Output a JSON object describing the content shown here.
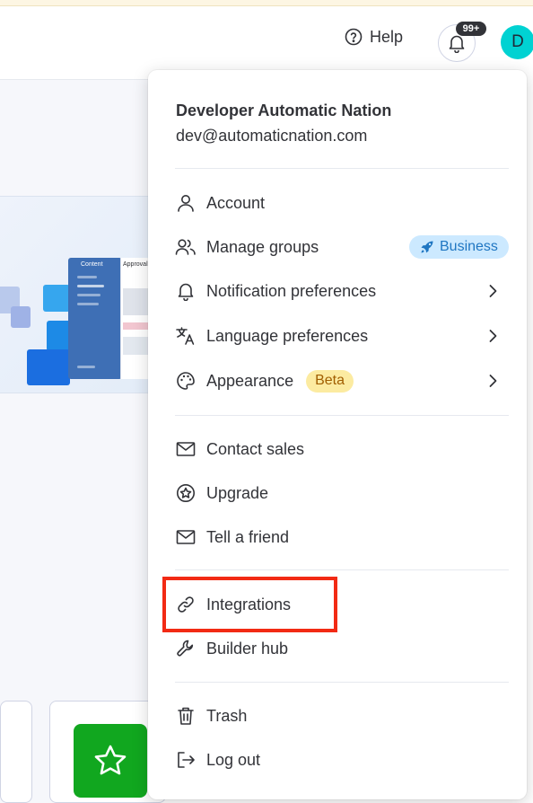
{
  "topbar": {
    "help_label": "Help",
    "help_icon": "question-circle-icon",
    "notifications_icon": "bell-icon",
    "notifications_count": "99+",
    "avatar_initial": "D"
  },
  "menu": {
    "user_name": "Developer Automatic Nation",
    "user_email": "dev@automaticnation.com",
    "items": [
      {
        "id": "account",
        "label": "Account",
        "icon": "user-icon"
      },
      {
        "id": "manage-groups",
        "label": "Manage groups",
        "icon": "users-icon",
        "badge": "Business",
        "badge_icon": "rocket-icon"
      },
      {
        "id": "notification-preferences",
        "label": "Notification preferences",
        "icon": "bell-icon",
        "has_submenu": true
      },
      {
        "id": "language-preferences",
        "label": "Language preferences",
        "icon": "translate-icon",
        "has_submenu": true
      },
      {
        "id": "appearance",
        "label": "Appearance",
        "icon": "palette-icon",
        "badge": "Beta",
        "has_submenu": true
      },
      {
        "id": "contact-sales",
        "label": "Contact sales",
        "icon": "envelope-icon"
      },
      {
        "id": "upgrade",
        "label": "Upgrade",
        "icon": "star-circle-icon"
      },
      {
        "id": "tell-a-friend",
        "label": "Tell a friend",
        "icon": "envelope-icon"
      },
      {
        "id": "integrations",
        "label": "Integrations",
        "icon": "link-icon",
        "highlighted": true
      },
      {
        "id": "builder-hub",
        "label": "Builder hub",
        "icon": "wrench-icon"
      },
      {
        "id": "trash",
        "label": "Trash",
        "icon": "trash-icon"
      },
      {
        "id": "log-out",
        "label": "Log out",
        "icon": "logout-icon"
      }
    ]
  },
  "background": {
    "banner_window_title": "Content",
    "banner_panel_title": "Approvals",
    "star_tile_icon": "star-icon"
  },
  "colors": {
    "avatar": "#00d2d2",
    "business_badge_bg": "#cce9ff",
    "beta_badge_bg": "#fceba1",
    "highlight_box": "#f22a14",
    "star_tile": "#11a71f"
  }
}
